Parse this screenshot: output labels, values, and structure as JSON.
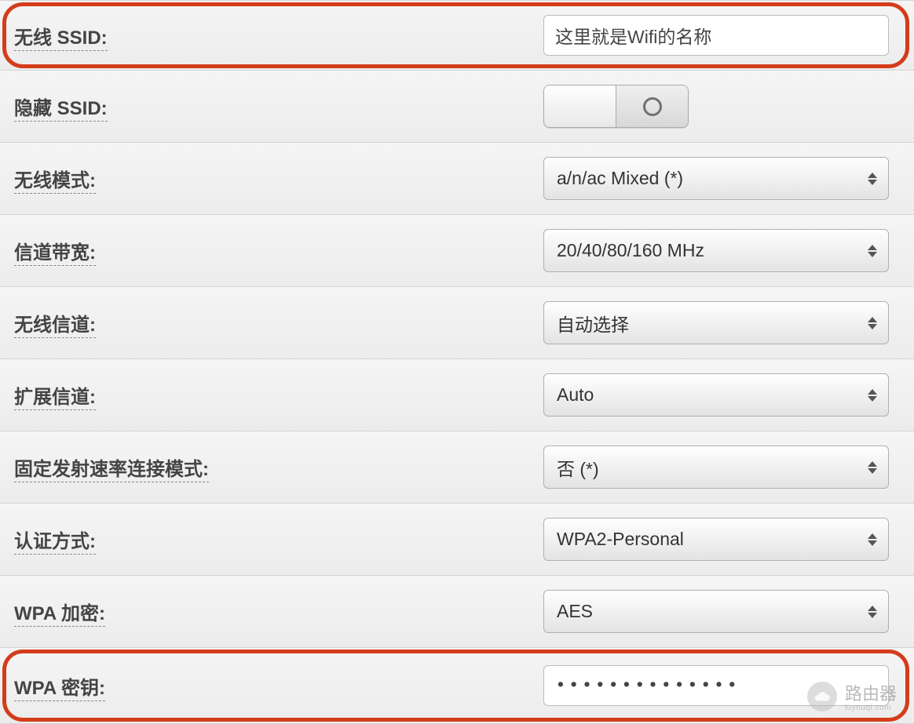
{
  "rows": {
    "ssid": {
      "label": "无线 SSID:",
      "value": "这里就是Wifi的名称"
    },
    "hide_ssid": {
      "label": "隐藏 SSID:",
      "state": "off"
    },
    "wireless_mode": {
      "label": "无线模式:",
      "value": "a/n/ac Mixed (*)"
    },
    "channel_width": {
      "label": "信道带宽:",
      "value": "20/40/80/160 MHz"
    },
    "wireless_channel": {
      "label": "无线信道:",
      "value": "自动选择"
    },
    "extension_channel": {
      "label": "扩展信道:",
      "value": "Auto"
    },
    "fixed_rate_mode": {
      "label": "固定发射速率连接模式:",
      "value": "否 (*)"
    },
    "auth_method": {
      "label": "认证方式:",
      "value": "WPA2-Personal"
    },
    "wpa_encryption": {
      "label": "WPA 加密:",
      "value": "AES"
    },
    "wpa_key": {
      "label": "WPA 密钥:",
      "value": "••••••••••••••"
    }
  },
  "watermark": {
    "text": "路由器",
    "sub": "luyouqi.com"
  }
}
